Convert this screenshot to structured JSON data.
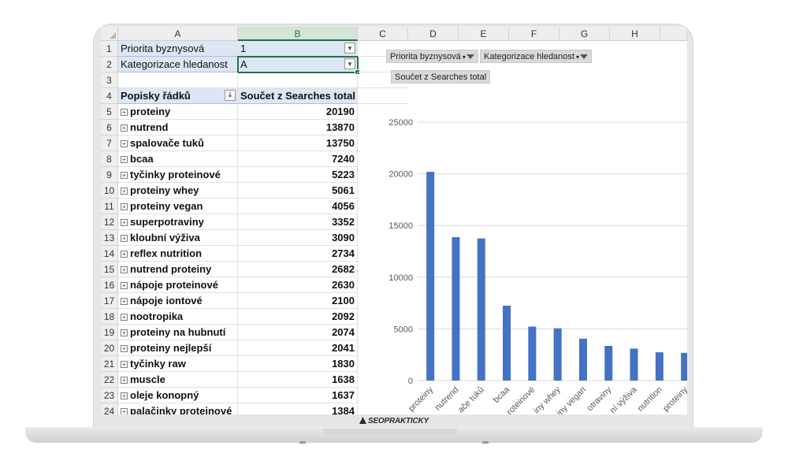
{
  "columns": [
    "A",
    "B",
    "C",
    "D",
    "E",
    "F",
    "G",
    "H"
  ],
  "rows": [
    "1",
    "2",
    "3",
    "4",
    "5",
    "6",
    "7",
    "8",
    "9",
    "10",
    "11",
    "12",
    "13",
    "14",
    "15",
    "16",
    "17",
    "18",
    "19",
    "20",
    "21",
    "22",
    "23",
    "24"
  ],
  "filters": [
    {
      "label": "Priorita byznysová",
      "value": "1"
    },
    {
      "label": "Kategorizace hledanost",
      "value": "A"
    }
  ],
  "pivot": {
    "row_header": "Popisky řádků",
    "value_header": "Součet z Searches total",
    "items": [
      {
        "name": "proteiny",
        "value": "20190"
      },
      {
        "name": "nutrend",
        "value": "13870"
      },
      {
        "name": "spalovače tuků",
        "value": "13750"
      },
      {
        "name": "bcaa",
        "value": "7240"
      },
      {
        "name": "tyčinky proteinové",
        "value": "5223"
      },
      {
        "name": "proteiny whey",
        "value": "5061"
      },
      {
        "name": "proteiny vegan",
        "value": "4056"
      },
      {
        "name": "superpotraviny",
        "value": "3352"
      },
      {
        "name": "kloubní výživa",
        "value": "3090"
      },
      {
        "name": "reflex nutrition",
        "value": "2734"
      },
      {
        "name": "nutrend proteiny",
        "value": "2682"
      },
      {
        "name": "nápoje proteinové",
        "value": "2630"
      },
      {
        "name": "nápoje iontové",
        "value": "2100"
      },
      {
        "name": "nootropika",
        "value": "2092"
      },
      {
        "name": "proteiny na hubnutí",
        "value": "2074"
      },
      {
        "name": "proteiny nejlepší",
        "value": "2041"
      },
      {
        "name": "tyčinky raw",
        "value": "1830"
      },
      {
        "name": "muscle",
        "value": "1638"
      },
      {
        "name": "oleje konopný",
        "value": "1637"
      },
      {
        "name": "palačinky proteinové",
        "value": "1384"
      }
    ]
  },
  "chart_buttons": {
    "filter1": "Priorita byznysová",
    "filter2": "Kategorizace hledanost",
    "value_field": "Součet z Searches total"
  },
  "chart_data": {
    "type": "bar",
    "categories": [
      "proteiny",
      "nutrend",
      "spalovače tuků",
      "bcaa",
      "tyčinky proteinové",
      "proteiny whey",
      "proteiny vegan",
      "superpotraviny",
      "kloubní výživa",
      "reflex nutrition",
      "nutrend proteiny"
    ],
    "tick_labels": [
      "proteiny",
      "nutrend",
      "ače tuků",
      "bcaa",
      "roteinové",
      "iny whey",
      "iny vegan",
      "otraviny",
      "ní výživa",
      "nutrition",
      "proteiny"
    ],
    "values": [
      20190,
      13870,
      13750,
      7240,
      5223,
      5061,
      4056,
      3352,
      3090,
      2734,
      2682
    ],
    "ylim": [
      0,
      25000
    ],
    "yticks": [
      "0",
      "5000",
      "10000",
      "15000",
      "20000",
      "25000"
    ],
    "grid": true,
    "bar_color": "#4472c4"
  },
  "brand": "SEOPRAKTICKY"
}
